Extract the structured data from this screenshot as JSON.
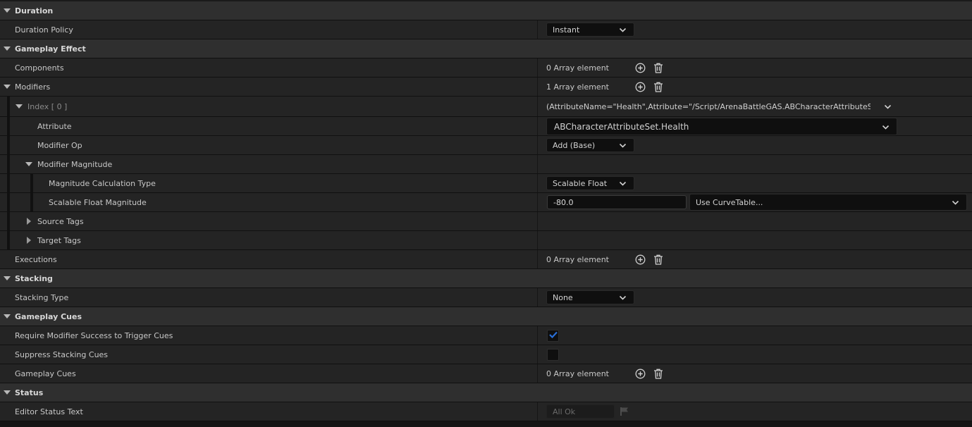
{
  "sections": {
    "duration": {
      "title": "Duration",
      "policy_label": "Duration Policy",
      "policy_value": "Instant"
    },
    "gameplay_effect": {
      "title": "Gameplay Effect",
      "components_label": "Components",
      "components_count": "0 Array element",
      "modifiers_label": "Modifiers",
      "modifiers_count": "1 Array element",
      "index_label": "Index [ 0 ]",
      "index_value": "(AttributeName=\"Health\",Attribute=\"/Script/ArenaBattleGAS.ABCharacterAttributeSet:Health",
      "attribute_label": "Attribute",
      "attribute_value": "ABCharacterAttributeSet.Health",
      "modifier_op_label": "Modifier Op",
      "modifier_op_value": "Add (Base)",
      "modifier_magnitude_label": "Modifier Magnitude",
      "calc_type_label": "Magnitude Calculation Type",
      "calc_type_value": "Scalable Float",
      "scalable_label": "Scalable Float Magnitude",
      "scalable_value": "-80.0",
      "curve_table_value": "Use CurveTable...",
      "source_tags_label": "Source Tags",
      "target_tags_label": "Target Tags",
      "executions_label": "Executions",
      "executions_count": "0 Array element"
    },
    "stacking": {
      "title": "Stacking",
      "type_label": "Stacking Type",
      "type_value": "None"
    },
    "gameplay_cues": {
      "title": "Gameplay Cues",
      "require_label": "Require Modifier Success to Trigger Cues",
      "require_checked": true,
      "suppress_label": "Suppress Stacking Cues",
      "suppress_checked": false,
      "cues_label": "Gameplay Cues",
      "cues_count": "0 Array element"
    },
    "status": {
      "title": "Status",
      "editor_status_label": "Editor Status Text",
      "editor_status_value": "All Ok"
    }
  },
  "colors": {
    "category_bg": "#2f2f2f",
    "row_bg": "#242424",
    "check_accent": "#2a6fd8"
  },
  "icons": [
    "chevron-down-icon",
    "expand-arrow-icon",
    "collapse-arrow-icon",
    "add-circle-icon",
    "trash-icon",
    "checkmark-icon",
    "flag-icon"
  ]
}
